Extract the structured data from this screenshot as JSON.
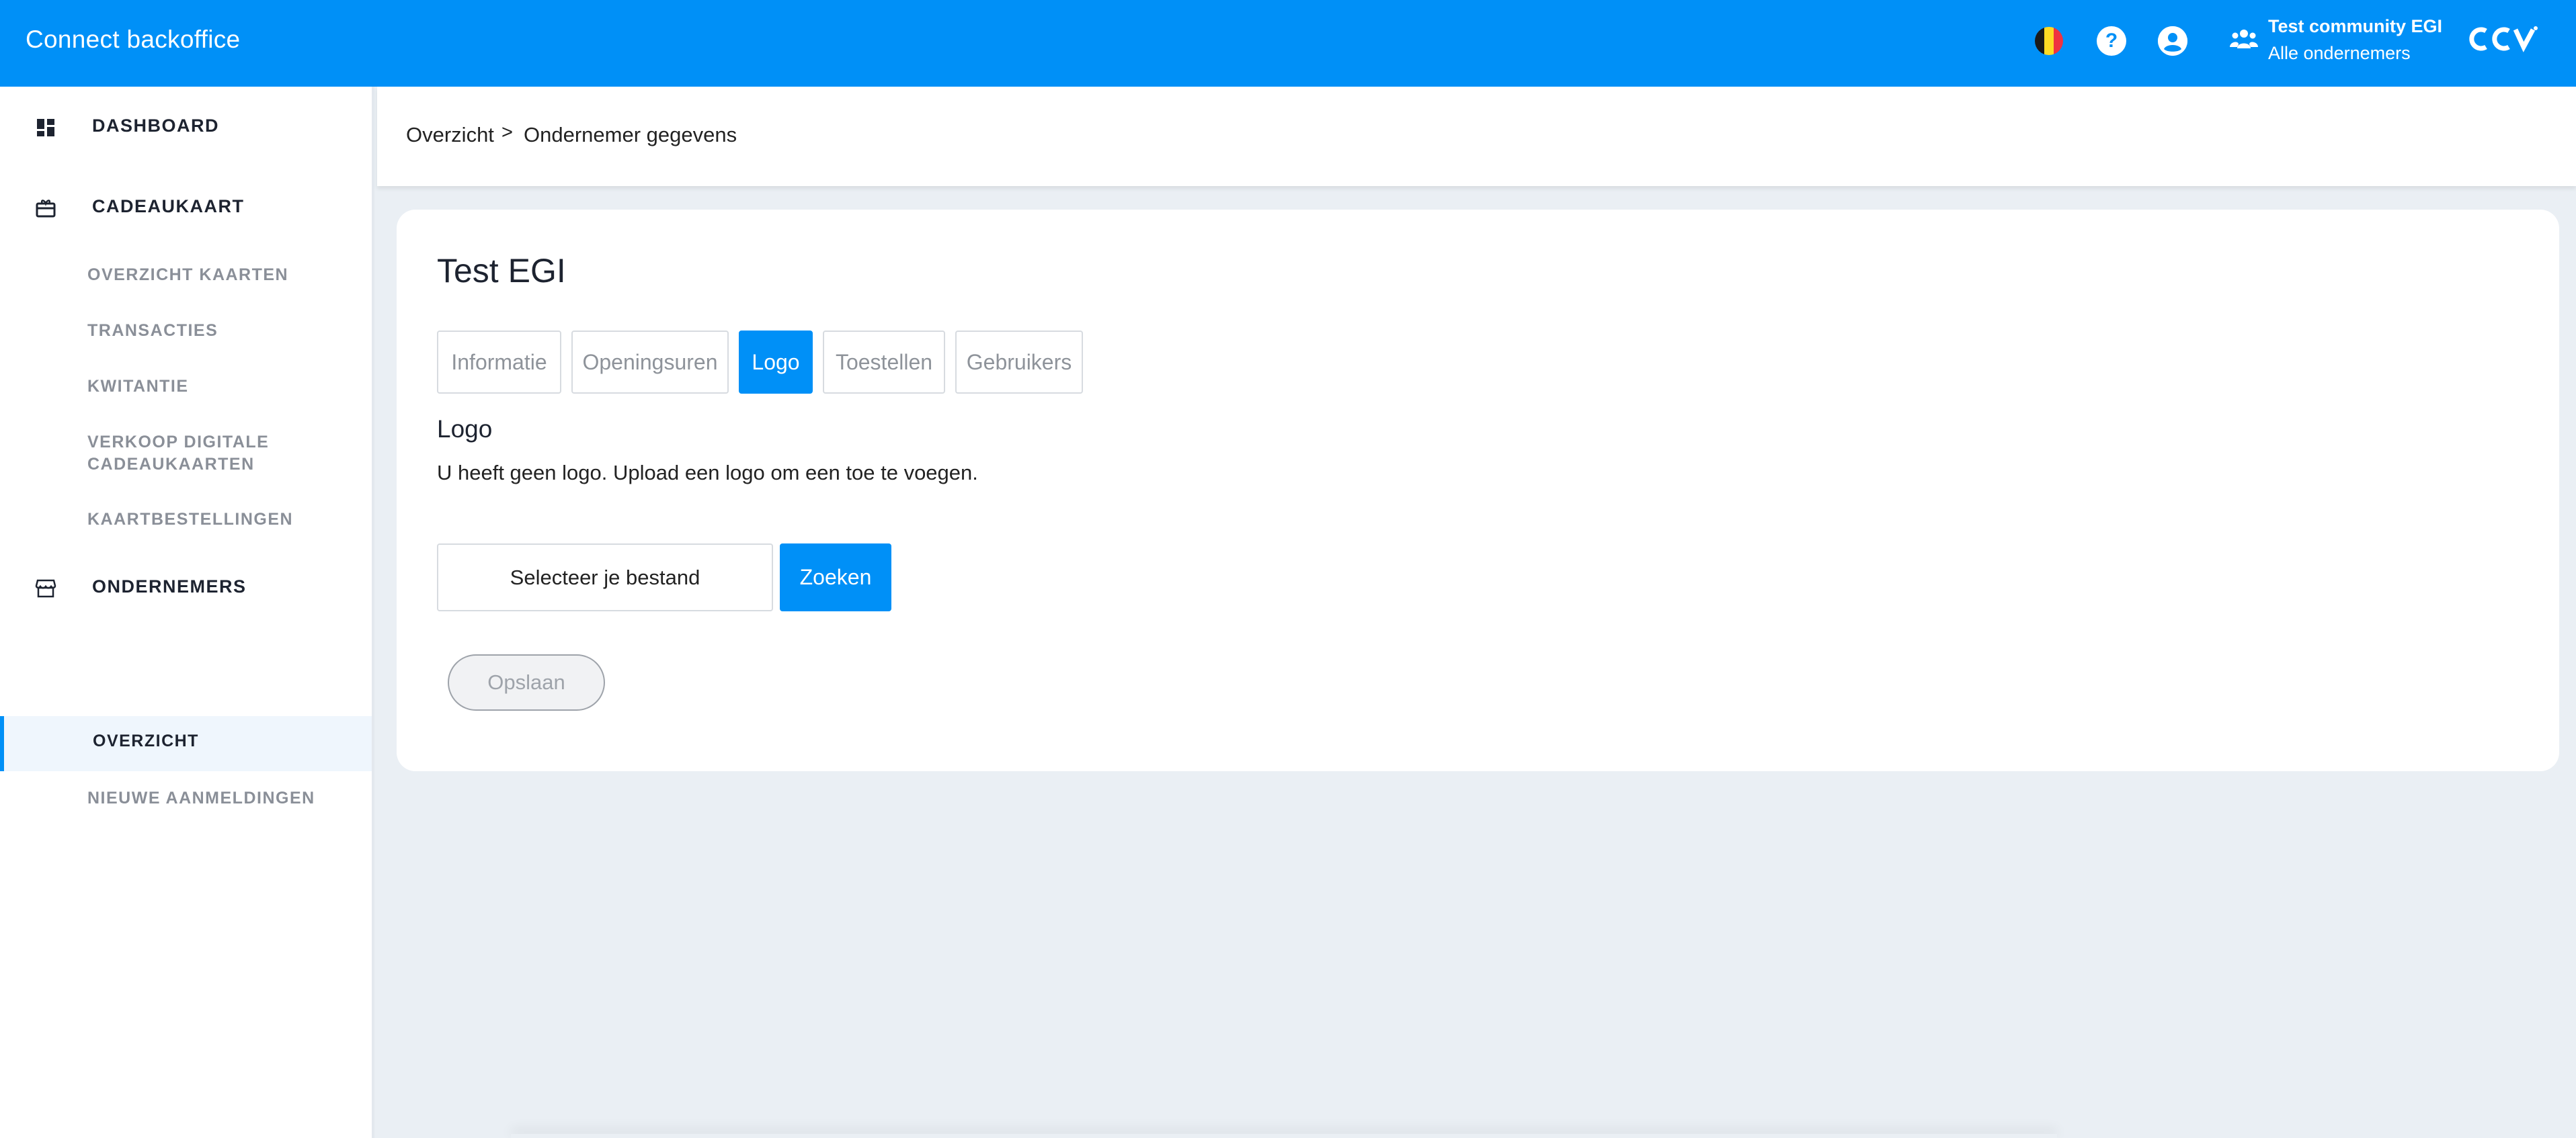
{
  "header": {
    "app_title": "Connect backoffice",
    "flag_colors": [
      "#1a1a1a",
      "#fdda24",
      "#ef3340"
    ],
    "help_icon": "?",
    "community_name": "Test community EGI",
    "community_sub": "Alle ondernemers",
    "brand_logo": "CCV",
    "accent_color": "#0090f7"
  },
  "sidebar": {
    "dashboard": "DASHBOARD",
    "cadeaukaart": "CADEAUKAART",
    "cadeaukaart_items": [
      "OVERZICHT KAARTEN",
      "TRANSACTIES",
      "KWITANTIE",
      "VERKOOP DIGITALE",
      "CADEAUKAARTEN",
      "KAARTBESTELLINGEN"
    ],
    "ondernemers": "ONDERNEMERS",
    "ondernemers_items": [
      "OVERZICHT",
      "NIEUWE AANMELDINGEN"
    ]
  },
  "breadcrumb": {
    "root": "Overzicht",
    "separator": ">",
    "current": "Ondernemer gegevens"
  },
  "main": {
    "title": "Test EGI",
    "tabs": [
      "Informatie",
      "Openingsuren",
      "Logo",
      "Toestellen",
      "Gebruikers"
    ],
    "active_tab": "Logo",
    "section_title": "Logo",
    "section_text": "U heeft geen logo. Upload een logo om een toe te voegen.",
    "file_placeholder": "Selecteer je bestand",
    "search_label": "Zoeken",
    "save_label": "Opslaan"
  }
}
